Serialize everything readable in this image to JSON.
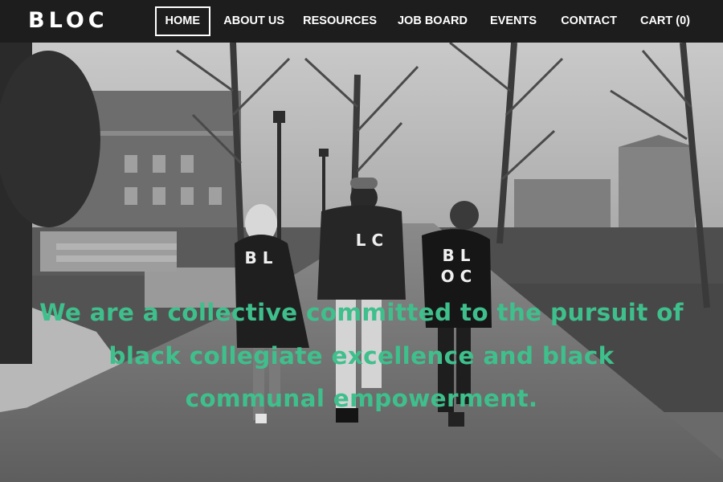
{
  "header": {
    "logo": "BLOC",
    "nav": [
      {
        "label": "HOME",
        "active": true
      },
      {
        "label": "ABOUT US"
      },
      {
        "label": "RESOURCES"
      },
      {
        "label": "JOB BOARD"
      },
      {
        "label": "EVENTS"
      },
      {
        "label": "CONTACT"
      },
      {
        "label": "CART (0)"
      }
    ]
  },
  "hero": {
    "tagline_lines": [
      "We are a collective committed to the pursuit of",
      "black collegiate excellence and black",
      "communal empowerment."
    ],
    "shirt_letters": [
      "B L",
      "L C",
      "B L",
      "O C"
    ]
  },
  "colors": {
    "header_bg": "#1d1d1d",
    "accent_green": "#3fbf8c",
    "nav_text": "#ffffff"
  }
}
